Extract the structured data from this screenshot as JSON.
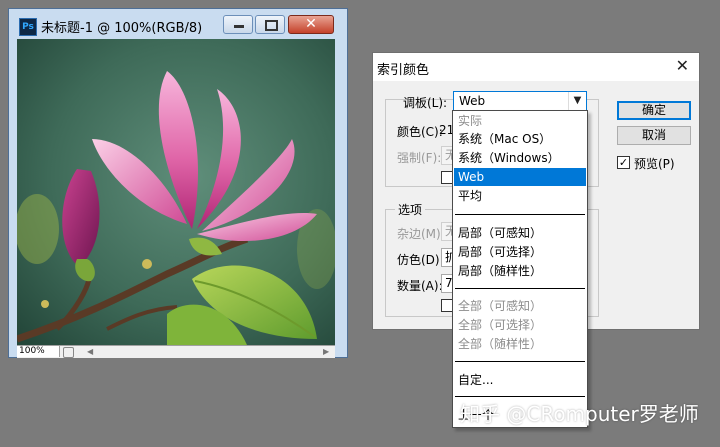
{
  "document_window": {
    "title": "未标题-1 @ 100%(RGB/8)",
    "app_icon_text": "Ps",
    "minimize_glyph": "",
    "close_glyph": "✕",
    "canvas_image": "pink magnolia flower photo",
    "status": {
      "zoom": "100%"
    }
  },
  "indexed_color_dialog": {
    "title": "索引颜色",
    "close_glyph": "✕",
    "palette_label": "调板(L):",
    "palette_value": "Web",
    "colors_label": "颜色(C):",
    "colors_value": "21",
    "forced_label": "强制(F):",
    "forced_value": "无",
    "options_legend": "选项",
    "matte_label": "杂边(M):",
    "matte_value": "无",
    "dither_label": "仿色(D):",
    "dither_value": "扩",
    "amount_label": "数量(A):",
    "amount_value": "75",
    "ok_button": "确定",
    "cancel_button": "取消",
    "preview_label": "预览(P)",
    "preview_checked": true,
    "check_glyph": "✓"
  },
  "palette_dropdown": {
    "options": [
      {
        "label": "实际",
        "enabled": false
      },
      {
        "label": "系统（Mac OS）",
        "enabled": true
      },
      {
        "label": "系统（Windows）",
        "enabled": true
      },
      {
        "label": "Web",
        "enabled": true,
        "selected": true
      },
      {
        "label": "平均",
        "enabled": true
      },
      {
        "label": "局部（可感知）",
        "enabled": true
      },
      {
        "label": "局部（可选择）",
        "enabled": true
      },
      {
        "label": "局部（随样性）",
        "enabled": true
      },
      {
        "label": "全部（可感知）",
        "enabled": false
      },
      {
        "label": "全部（可选择）",
        "enabled": false
      },
      {
        "label": "全部（随样性）",
        "enabled": false
      },
      {
        "label": "自定...",
        "enabled": true
      },
      {
        "label": "上一个",
        "enabled": true
      }
    ]
  },
  "watermark": "知乎 @CRomputer罗老师",
  "colors": {
    "desktop": "#7b7b7b",
    "selection": "#0078d7",
    "window_frame": "#c9dcf0"
  }
}
